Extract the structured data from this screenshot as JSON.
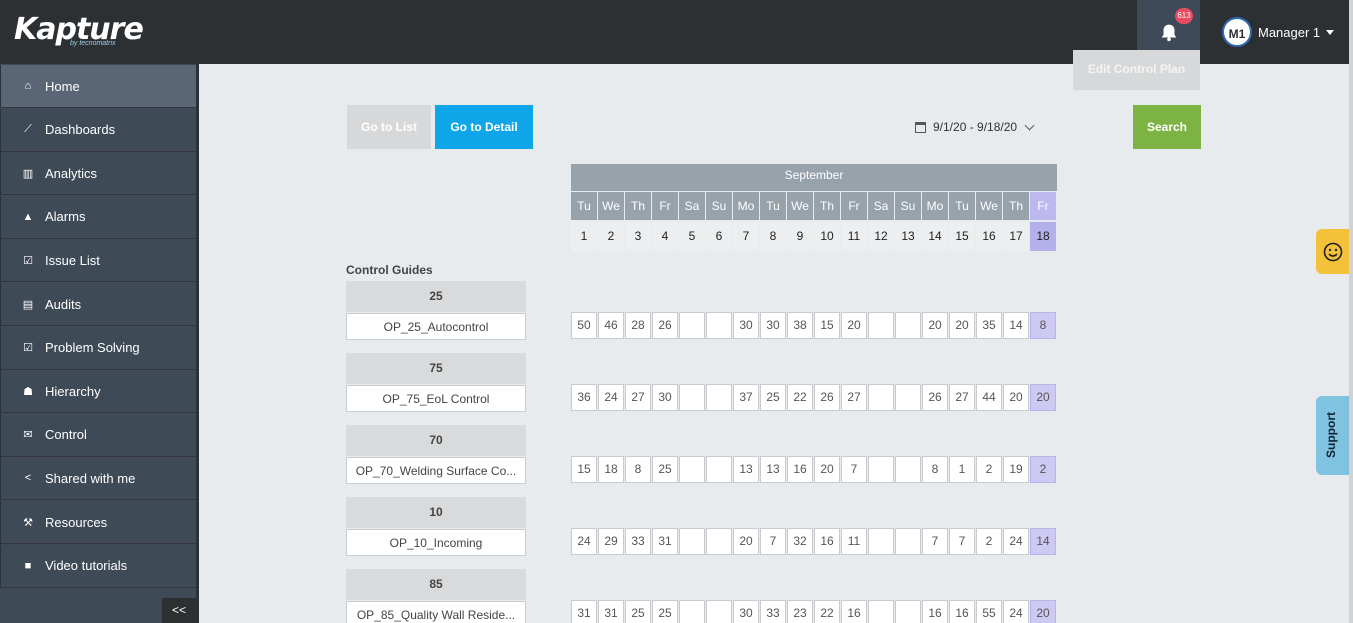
{
  "header": {
    "logo": "Kapture",
    "logo_sub": "by tecnomatrix",
    "notifications_count": "613",
    "user_initials": "M1",
    "user_name": "Manager 1"
  },
  "sidebar": {
    "items": [
      {
        "label": "Home",
        "icon": "home-icon"
      },
      {
        "label": "Dashboards",
        "icon": "line-chart-icon"
      },
      {
        "label": "Analytics",
        "icon": "bar-chart-icon"
      },
      {
        "label": "Alarms",
        "icon": "warning-icon"
      },
      {
        "label": "Issue List",
        "icon": "checkbox-icon"
      },
      {
        "label": "Audits",
        "icon": "document-icon"
      },
      {
        "label": "Problem Solving",
        "icon": "checkbox-icon"
      },
      {
        "label": "Hierarchy",
        "icon": "users-icon"
      },
      {
        "label": "Control",
        "icon": "inbox-icon"
      },
      {
        "label": "Shared with me",
        "icon": "share-icon"
      },
      {
        "label": "Resources",
        "icon": "wrench-icon"
      },
      {
        "label": "Video tutorials",
        "icon": "video-icon"
      }
    ],
    "collapse_label": "<<"
  },
  "toolbar": {
    "edit_label": "Edit Control Plan",
    "list_label": "Go to List",
    "detail_label": "Go to Detail",
    "date_range": "9/1/20 - 9/18/20",
    "search_label": "Search"
  },
  "calendar": {
    "month": "September",
    "days": [
      "Tu",
      "We",
      "Th",
      "Fr",
      "Sa",
      "Su",
      "Mo",
      "Tu",
      "We",
      "Th",
      "Fr",
      "Sa",
      "Su",
      "Mo",
      "Tu",
      "We",
      "Th",
      "Fr"
    ],
    "dates": [
      "1",
      "2",
      "3",
      "4",
      "5",
      "6",
      "7",
      "8",
      "9",
      "10",
      "11",
      "12",
      "13",
      "14",
      "15",
      "16",
      "17",
      "18"
    ],
    "selected_index": 17
  },
  "control_guides": {
    "title": "Control Guides",
    "groups": [
      {
        "id": "25",
        "name": "OP_25_Autocontrol",
        "values": [
          "50",
          "46",
          "28",
          "26",
          "",
          "",
          "30",
          "30",
          "38",
          "15",
          "20",
          "",
          "",
          "20",
          "20",
          "35",
          "14",
          "8"
        ]
      },
      {
        "id": "75",
        "name": "OP_75_EoL Control",
        "values": [
          "36",
          "24",
          "27",
          "30",
          "",
          "",
          "37",
          "25",
          "22",
          "26",
          "27",
          "",
          "",
          "26",
          "27",
          "44",
          "20",
          "20"
        ]
      },
      {
        "id": "70",
        "name": "OP_70_Welding Surface Co...",
        "values": [
          "15",
          "18",
          "8",
          "25",
          "",
          "",
          "13",
          "13",
          "16",
          "20",
          "7",
          "",
          "",
          "8",
          "1",
          "2",
          "19",
          "2"
        ]
      },
      {
        "id": "10",
        "name": "OP_10_Incoming",
        "values": [
          "24",
          "29",
          "33",
          "31",
          "",
          "",
          "20",
          "7",
          "32",
          "16",
          "11",
          "",
          "",
          "7",
          "7",
          "2",
          "24",
          "14"
        ]
      },
      {
        "id": "85",
        "name": "OP_85_Quality Wall Reside...",
        "values": [
          "31",
          "31",
          "25",
          "25",
          "",
          "",
          "30",
          "33",
          "23",
          "22",
          "16",
          "",
          "",
          "16",
          "16",
          "55",
          "24",
          "20"
        ]
      }
    ]
  },
  "widgets": {
    "support_label": "Support"
  }
}
